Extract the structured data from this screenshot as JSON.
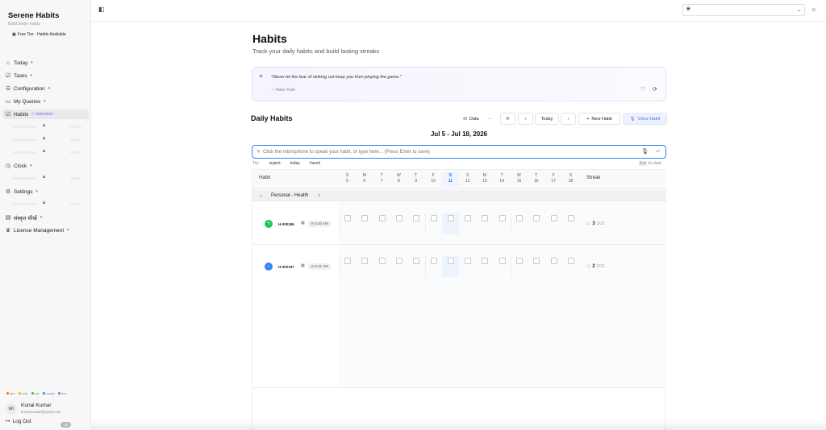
{
  "sidebar": {
    "brand": "Serene Habits",
    "tagline": "Build better habits",
    "tier": "Free Tier - Habits Available",
    "items": [
      {
        "label": "Today",
        "icon": "home-icon"
      },
      {
        "label": "Tasks",
        "icon": "checklist-icon"
      },
      {
        "label": "Configuration",
        "icon": "sliders-icon"
      },
      {
        "label": "My Queries",
        "icon": "chat-icon"
      },
      {
        "label": "Habits",
        "icon": "check-square-icon",
        "badge": "✓ Unlocked"
      },
      {
        "label": "Clock",
        "icon": "clock-icon"
      },
      {
        "label": "Settings",
        "icon": "gear-icon"
      },
      {
        "label": "संस्कृत शीखें",
        "icon": "book-icon"
      },
      {
        "label": "License Management",
        "icon": "crown-icon"
      }
    ],
    "status_keys": [
      {
        "label": "dev",
        "color": "#f97316"
      },
      {
        "label": "test",
        "color": "#eab308"
      },
      {
        "label": "uat",
        "color": "#22c55e"
      },
      {
        "label": "ready",
        "color": "#3b82f6"
      },
      {
        "label": "live",
        "color": "#a855f7"
      }
    ],
    "user": {
      "initials": "KK",
      "name": "Kunal Kumar",
      "email": "kunal.kumar@gmail.com"
    },
    "logout": "Log Out",
    "version": "38"
  },
  "header": {
    "language": "",
    "theme_icon": "sun-icon"
  },
  "main": {
    "title": "Habits",
    "subtitle": "Track your daily habits and build lasting streaks",
    "quote": {
      "text": "\"Never let the fear of striking out keep you from playing the game.\"",
      "author": "— Babe Ruth"
    },
    "section_title": "Daily Habits",
    "toolbar": {
      "data": "Data",
      "more": "···",
      "today": "Today",
      "new_habit": "New Habit",
      "voice_habit": "Voice Habit"
    },
    "date_range": "Jul 5 - Jul 18, 2026",
    "input_placeholder": "Click the microphone to speak your habit, or type here... (Press Enter to save)",
    "try_label": "Try:",
    "try_tags": [
      "urgent",
      "today",
      "#work"
    ],
    "esc_key": "Esc",
    "esc_hint": "to clear",
    "grid": {
      "habit_header": "Habit",
      "streak_header": "Streak",
      "days": [
        {
          "d": "S",
          "n": "5"
        },
        {
          "d": "M",
          "n": "6"
        },
        {
          "d": "T",
          "n": "7"
        },
        {
          "d": "W",
          "n": "8"
        },
        {
          "d": "T",
          "n": "9"
        },
        {
          "d": "F",
          "n": "10"
        },
        {
          "d": "S",
          "n": "11",
          "today": true
        },
        {
          "d": "S",
          "n": "12"
        },
        {
          "d": "M",
          "n": "13"
        },
        {
          "d": "T",
          "n": "14"
        },
        {
          "d": "W",
          "n": "15"
        },
        {
          "d": "T",
          "n": "16"
        },
        {
          "d": "F",
          "n": "17"
        },
        {
          "d": "S",
          "n": "18"
        }
      ],
      "group": {
        "name": "Personal - Health",
        "close": "x"
      },
      "habits": [
        {
          "name": "H-000186",
          "time": "5:30 AM",
          "color": "#22c55e",
          "icon": "+",
          "streak": "3",
          "total": "3/13"
        },
        {
          "name": "H-000187",
          "time": "5:31 AM",
          "color": "#3b82f6",
          "icon": "–",
          "streak": "2",
          "total": "3/12"
        }
      ]
    }
  }
}
